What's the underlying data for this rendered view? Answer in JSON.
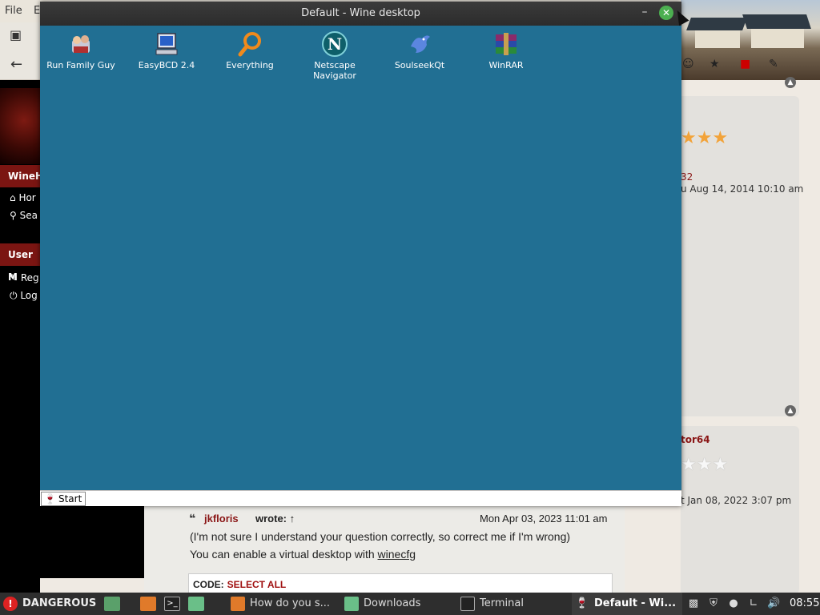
{
  "browser": {
    "menu": [
      "File",
      "E"
    ],
    "sidebar": {
      "wine_label": "WineH",
      "items": [
        "Hor",
        "Sea"
      ],
      "user_menu_label": "User M",
      "user_items": [
        "Reg",
        "Log"
      ]
    },
    "side_panel": {
      "user1_fragment": "32",
      "date1": "u Aug 14, 2014 10:10 am",
      "user2_fragment": "tor64",
      "date2": "t Jan 08, 2022 3:07 pm"
    },
    "post": {
      "author": "jkfloris",
      "wrote": "wrote: ↑",
      "date": "Mon Apr 03, 2023 11:01 am",
      "line1": "(I'm not sure I understand your question correctly, so correct me if I'm wrong)",
      "line2_prefix": "You can enable a virtual desktop with ",
      "line2_link": "winecfg",
      "code_label": "CODE:",
      "select_all": "SELECT ALL"
    }
  },
  "wine": {
    "title": "Default - Wine desktop",
    "icons": [
      {
        "label": "Run Family Guy",
        "icon": "family-guy-icon"
      },
      {
        "label": "EasyBCD 2.4",
        "icon": "easybcd-icon"
      },
      {
        "label": "Everything",
        "icon": "everything-search-icon"
      },
      {
        "label": "Netscape Navigator",
        "icon": "netscape-icon"
      },
      {
        "label": "SoulseekQt",
        "icon": "soulseek-bird-icon"
      },
      {
        "label": "WinRAR",
        "icon": "winrar-icon"
      }
    ],
    "start_label": "Start"
  },
  "taskbar": {
    "danger_label": "DANGEROUS",
    "tasks": [
      {
        "label": "How do you s..."
      },
      {
        "label": "Downloads"
      },
      {
        "label": "Terminal"
      },
      {
        "label": "Default - Wi..."
      }
    ],
    "clock": "08:55"
  }
}
